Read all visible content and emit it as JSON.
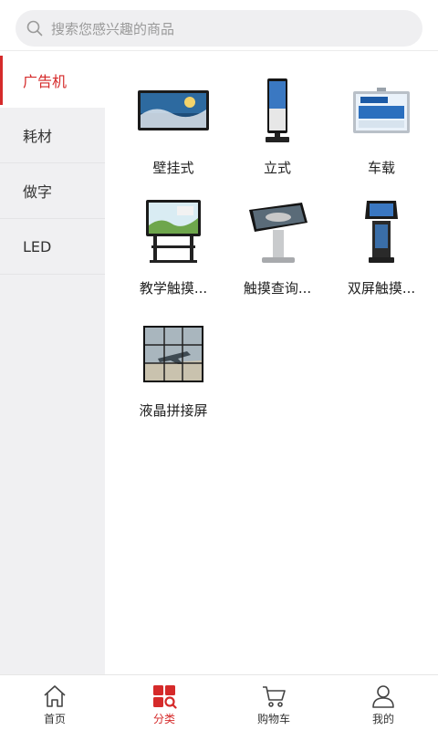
{
  "search": {
    "placeholder": "搜索您感兴趣的商品"
  },
  "sidebar": {
    "items": [
      {
        "label": "广告机",
        "active": true
      },
      {
        "label": "耗材"
      },
      {
        "label": "做字"
      },
      {
        "label": "LED"
      }
    ]
  },
  "grid": {
    "items": [
      {
        "label": "壁挂式",
        "icon": "wall-mount-display"
      },
      {
        "label": "立式",
        "icon": "standing-kiosk"
      },
      {
        "label": "车载",
        "icon": "vehicle-display"
      },
      {
        "label": "教学触摸...",
        "icon": "teaching-touch-display"
      },
      {
        "label": "触摸查询...",
        "icon": "touch-query-kiosk"
      },
      {
        "label": "双屏触摸...",
        "icon": "dual-screen-kiosk"
      },
      {
        "label": "液晶拼接屏",
        "icon": "lcd-video-wall"
      }
    ]
  },
  "tabbar": {
    "items": [
      {
        "label": "首页",
        "icon": "home-icon"
      },
      {
        "label": "分类",
        "icon": "category-icon",
        "active": true
      },
      {
        "label": "购物车",
        "icon": "cart-icon"
      },
      {
        "label": "我的",
        "icon": "user-icon"
      }
    ]
  },
  "colors": {
    "accent": "#d52a2a",
    "sidebar_bg": "#f0f0f2",
    "search_bg": "#efeff1"
  }
}
